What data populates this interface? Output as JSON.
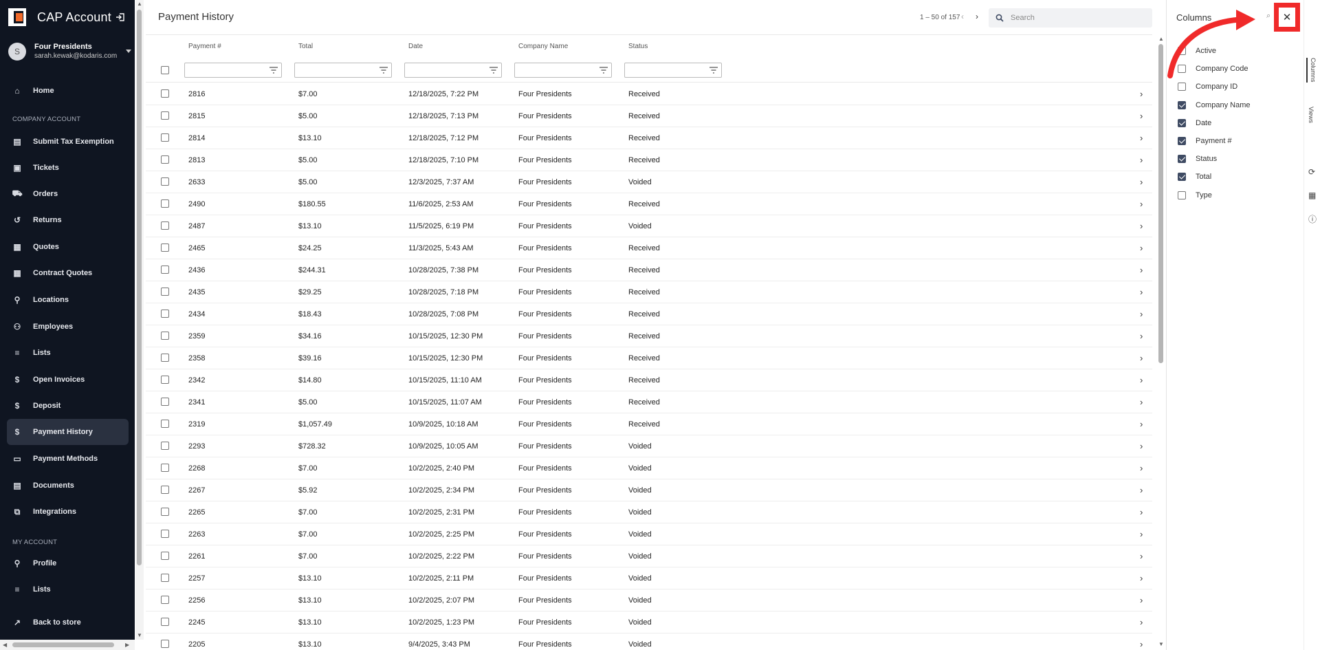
{
  "sidebar": {
    "title": "CAP Account",
    "account": {
      "initial": "S",
      "name": "Four Presidents",
      "email": "sarah.kewak@kodaris.com"
    },
    "sections": {
      "company": "COMPANY ACCOUNT",
      "my": "MY ACCOUNT"
    },
    "items": [
      {
        "label": "Home",
        "icon": "home-icon"
      },
      {
        "label": "Submit Tax Exemption",
        "icon": "document-icon"
      },
      {
        "label": "Tickets",
        "icon": "ticket-icon"
      },
      {
        "label": "Orders",
        "icon": "truck-icon"
      },
      {
        "label": "Returns",
        "icon": "return-icon"
      },
      {
        "label": "Quotes",
        "icon": "clipboard-icon"
      },
      {
        "label": "Contract Quotes",
        "icon": "clipboard-icon"
      },
      {
        "label": "Locations",
        "icon": "location-pin-icon"
      },
      {
        "label": "Employees",
        "icon": "people-icon"
      },
      {
        "label": "Lists",
        "icon": "list-icon"
      },
      {
        "label": "Open Invoices",
        "icon": "dollar-icon"
      },
      {
        "label": "Deposit",
        "icon": "dollar-icon"
      },
      {
        "label": "Payment History",
        "icon": "dollar-icon"
      },
      {
        "label": "Payment Methods",
        "icon": "card-icon"
      },
      {
        "label": "Documents",
        "icon": "document-icon"
      },
      {
        "label": "Integrations",
        "icon": "integrations-icon"
      },
      {
        "label": "Profile",
        "icon": "person-icon"
      },
      {
        "label": "Lists",
        "icon": "list-icon"
      },
      {
        "label": "Back to store",
        "icon": "external-icon"
      }
    ]
  },
  "main": {
    "title": "Payment History",
    "pager": "1 – 50 of 157",
    "search_placeholder": "Search",
    "columns": [
      "Payment #",
      "Total",
      "Date",
      "Company Name",
      "Status"
    ],
    "rows": [
      [
        "2816",
        "$7.00",
        "12/18/2025, 7:22 PM",
        "Four Presidents",
        "Received"
      ],
      [
        "2815",
        "$5.00",
        "12/18/2025, 7:13 PM",
        "Four Presidents",
        "Received"
      ],
      [
        "2814",
        "$13.10",
        "12/18/2025, 7:12 PM",
        "Four Presidents",
        "Received"
      ],
      [
        "2813",
        "$5.00",
        "12/18/2025, 7:10 PM",
        "Four Presidents",
        "Received"
      ],
      [
        "2633",
        "$5.00",
        "12/3/2025, 7:37 AM",
        "Four Presidents",
        "Voided"
      ],
      [
        "2490",
        "$180.55",
        "11/6/2025, 2:53 AM",
        "Four Presidents",
        "Received"
      ],
      [
        "2487",
        "$13.10",
        "11/5/2025, 6:19 PM",
        "Four Presidents",
        "Voided"
      ],
      [
        "2465",
        "$24.25",
        "11/3/2025, 5:43 AM",
        "Four Presidents",
        "Received"
      ],
      [
        "2436",
        "$244.31",
        "10/28/2025, 7:38 PM",
        "Four Presidents",
        "Received"
      ],
      [
        "2435",
        "$29.25",
        "10/28/2025, 7:18 PM",
        "Four Presidents",
        "Received"
      ],
      [
        "2434",
        "$18.43",
        "10/28/2025, 7:08 PM",
        "Four Presidents",
        "Received"
      ],
      [
        "2359",
        "$34.16",
        "10/15/2025, 12:30 PM",
        "Four Presidents",
        "Received"
      ],
      [
        "2358",
        "$39.16",
        "10/15/2025, 12:30 PM",
        "Four Presidents",
        "Received"
      ],
      [
        "2342",
        "$14.80",
        "10/15/2025, 11:10 AM",
        "Four Presidents",
        "Received"
      ],
      [
        "2341",
        "$5.00",
        "10/15/2025, 11:07 AM",
        "Four Presidents",
        "Received"
      ],
      [
        "2319",
        "$1,057.49",
        "10/9/2025, 10:18 AM",
        "Four Presidents",
        "Received"
      ],
      [
        "2293",
        "$728.32",
        "10/9/2025, 10:05 AM",
        "Four Presidents",
        "Voided"
      ],
      [
        "2268",
        "$7.00",
        "10/2/2025, 2:40 PM",
        "Four Presidents",
        "Voided"
      ],
      [
        "2267",
        "$5.92",
        "10/2/2025, 2:34 PM",
        "Four Presidents",
        "Voided"
      ],
      [
        "2265",
        "$7.00",
        "10/2/2025, 2:31 PM",
        "Four Presidents",
        "Voided"
      ],
      [
        "2263",
        "$7.00",
        "10/2/2025, 2:25 PM",
        "Four Presidents",
        "Voided"
      ],
      [
        "2261",
        "$7.00",
        "10/2/2025, 2:22 PM",
        "Four Presidents",
        "Voided"
      ],
      [
        "2257",
        "$13.10",
        "10/2/2025, 2:11 PM",
        "Four Presidents",
        "Voided"
      ],
      [
        "2256",
        "$13.10",
        "10/2/2025, 2:07 PM",
        "Four Presidents",
        "Voided"
      ],
      [
        "2245",
        "$13.10",
        "10/2/2025, 1:23 PM",
        "Four Presidents",
        "Voided"
      ],
      [
        "2205",
        "$13.10",
        "9/4/2025, 3:43 PM",
        "Four Presidents",
        "Voided"
      ]
    ]
  },
  "panel": {
    "title": "Columns",
    "close_glyph": "✕",
    "options": [
      {
        "label": "Active",
        "checked": false
      },
      {
        "label": "Company Code",
        "checked": false
      },
      {
        "label": "Company ID",
        "checked": false
      },
      {
        "label": "Company Name",
        "checked": true
      },
      {
        "label": "Date",
        "checked": true
      },
      {
        "label": "Payment #",
        "checked": true
      },
      {
        "label": "Status",
        "checked": true
      },
      {
        "label": "Total",
        "checked": true
      },
      {
        "label": "Type",
        "checked": false
      }
    ],
    "side_tabs": [
      "Columns",
      "Views"
    ]
  },
  "colors": {
    "sidebar_bg": "#0f1521",
    "accent": "#f06a2a",
    "highlight": "#f02a2a",
    "checkbox": "#3f4b63"
  }
}
